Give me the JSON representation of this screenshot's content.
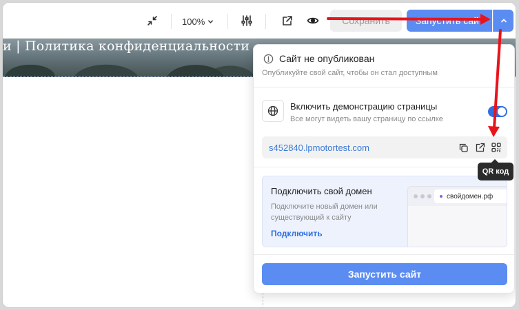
{
  "toolbar": {
    "zoom_label": "100%",
    "save_label": "Сохранить",
    "launch_label": "Запустить сайт"
  },
  "preview": {
    "hero_text": "и | Политика конфиденциальности"
  },
  "publish_panel": {
    "status_title": "Сайт не опубликован",
    "status_subtitle": "Опубликуйте свой сайт, чтобы он стал доступным",
    "demo_title": "Включить демонстрацию страницы",
    "demo_subtitle": "Все могут видеть вашу страницу по ссылке",
    "demo_enabled": true,
    "url": "s452840.lpmotortest.com",
    "domain_title": "Подключить свой домен",
    "domain_description": "Подключите новый домен или существующий к сайту",
    "domain_link": "Подключить",
    "domain_mock_address": "свойдомен.рф",
    "launch_button": "Запустить сайт"
  },
  "tooltip": {
    "text": "QR код"
  },
  "annotation_color": "#e8141c",
  "accent_color": "#5b8cf1"
}
